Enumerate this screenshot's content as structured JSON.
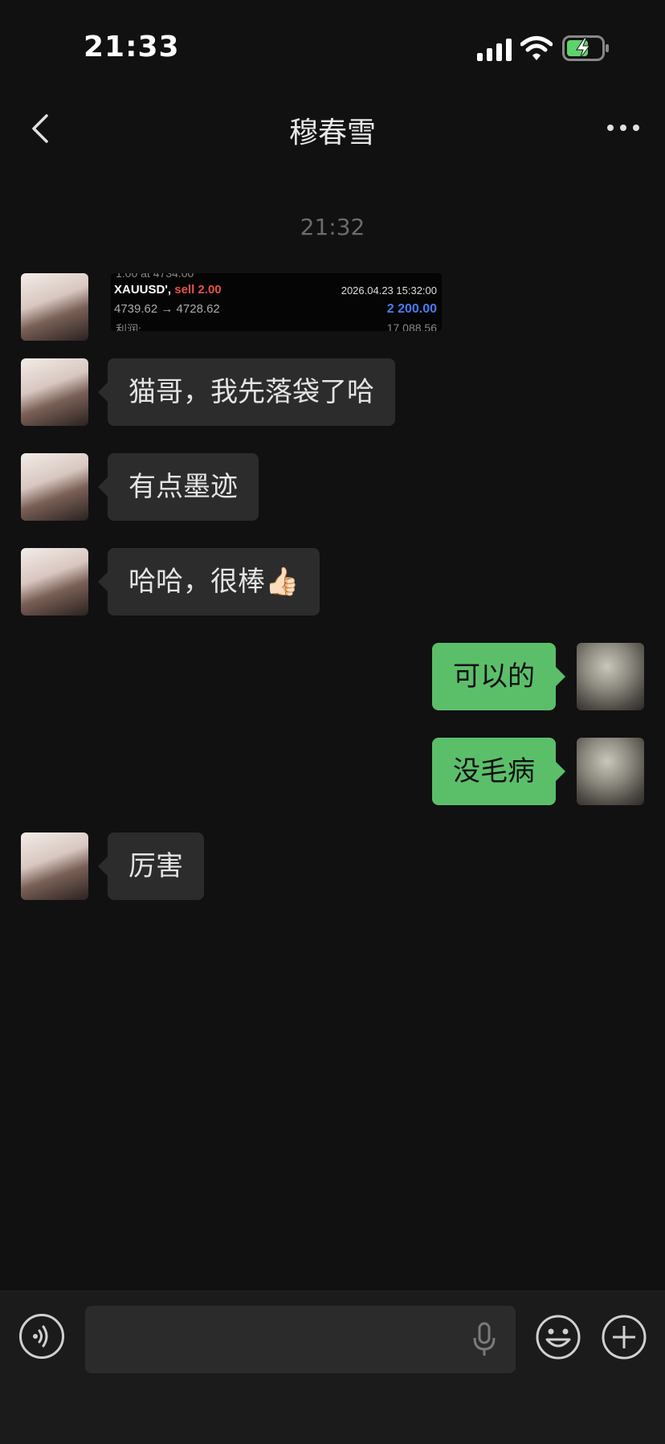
{
  "status": {
    "time": "21:33"
  },
  "header": {
    "title": "穆春雪"
  },
  "timestamp": "21:32",
  "trade_card": {
    "symbol": "XAUUSD',",
    "side": "sell 2.00",
    "date": "2026.04.23 15:32:00",
    "price_range": "4739.62 → 4728.62",
    "profit": "2 200.00",
    "top_partial": "1.00 at 4734.00",
    "bottom_left": "利润:",
    "bottom_right": "17 088.56"
  },
  "messages": [
    {
      "side": "left",
      "text": "猫哥，我先落袋了哈"
    },
    {
      "side": "left",
      "text": "有点墨迹"
    },
    {
      "side": "left",
      "text": "哈哈，很棒👍🏻"
    },
    {
      "side": "right",
      "text": "可以的"
    },
    {
      "side": "right",
      "text": "没毛病"
    },
    {
      "side": "left",
      "text": "厉害"
    }
  ],
  "input": {
    "placeholder": ""
  },
  "colors": {
    "bg": "#111111",
    "sent_bubble": "#5bbf6a",
    "received_bubble": "#2c2c2c",
    "sell": "#e5534b",
    "profit": "#4a7bef"
  },
  "icons": [
    "back-icon",
    "more-icon",
    "signal-icon",
    "wifi-icon",
    "battery-icon",
    "voice-icon",
    "mic-icon",
    "emoji-icon",
    "plus-icon"
  ]
}
